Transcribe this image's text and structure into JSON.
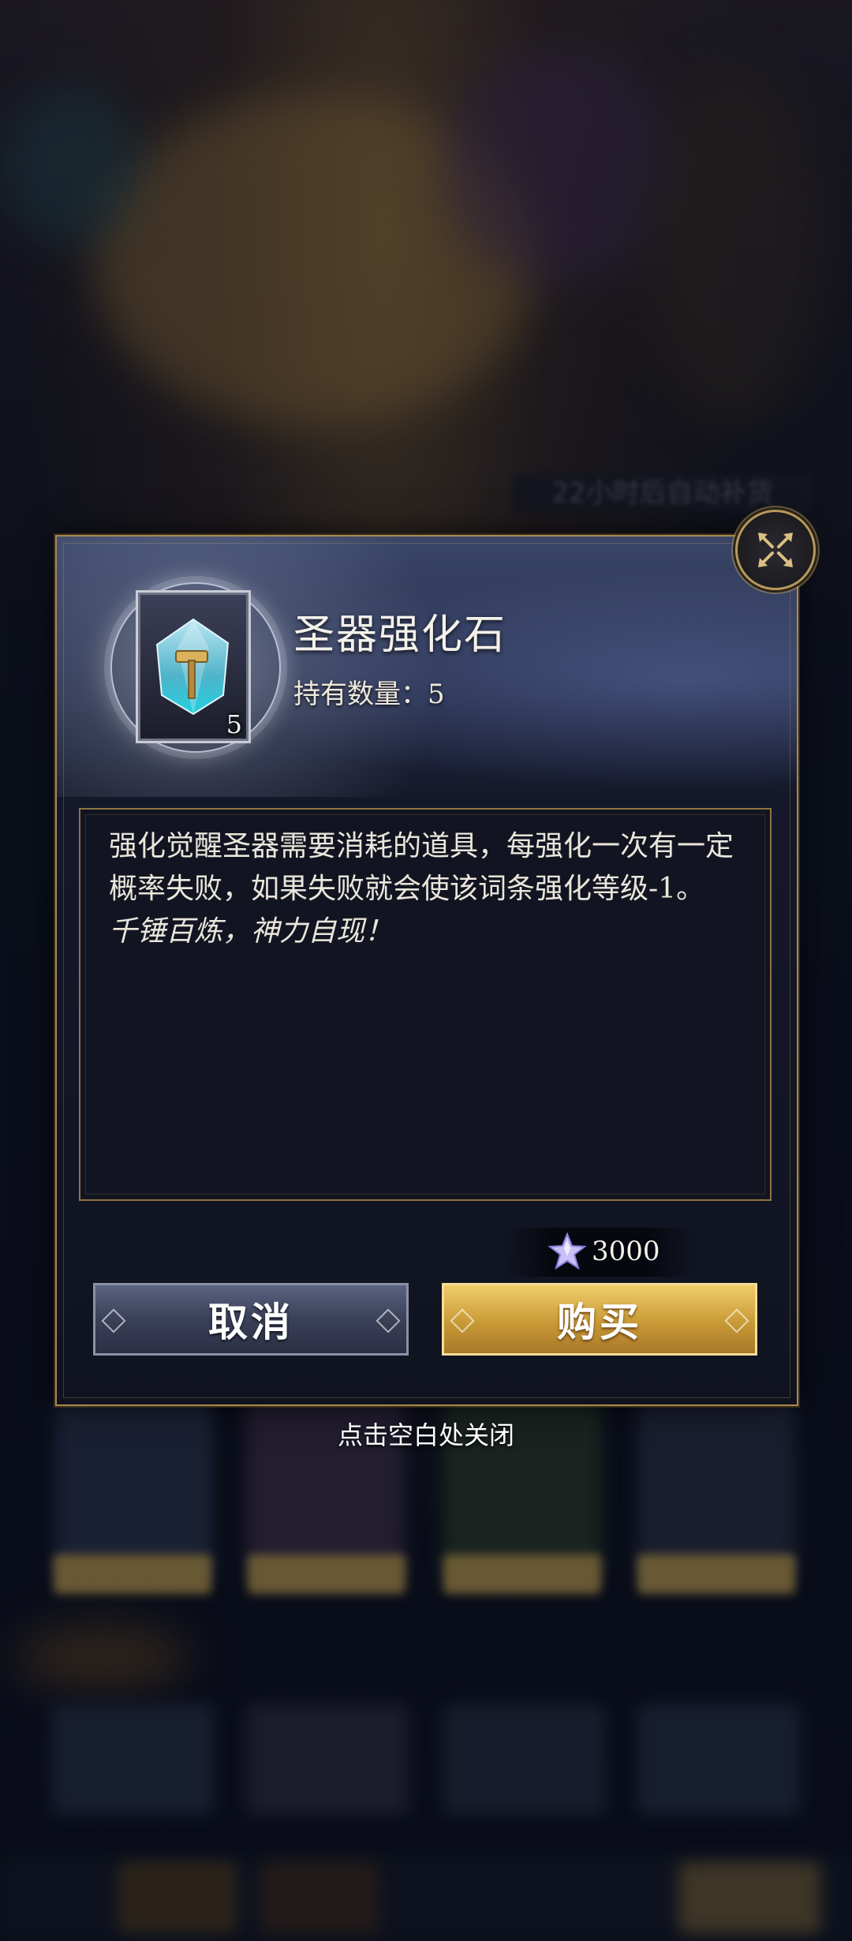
{
  "background": {
    "banner_text": "22小时后自动补货"
  },
  "dialog": {
    "item_title": "圣器强化石",
    "owned_label": "持有数量：5",
    "item_count": "5",
    "description": "强化觉醒圣器需要消耗的道具，每强化一次有一定概率失败，如果失败就会使该词条强化等级-1。",
    "quote": "千锤百炼，神力自现！",
    "price": "3000",
    "cancel_label": "取消",
    "buy_label": "购买",
    "dismiss_hint": "点击空白处关闭"
  },
  "colors": {
    "gold": "#c99a36",
    "frame": "#a88a52",
    "panel": "#121521"
  }
}
